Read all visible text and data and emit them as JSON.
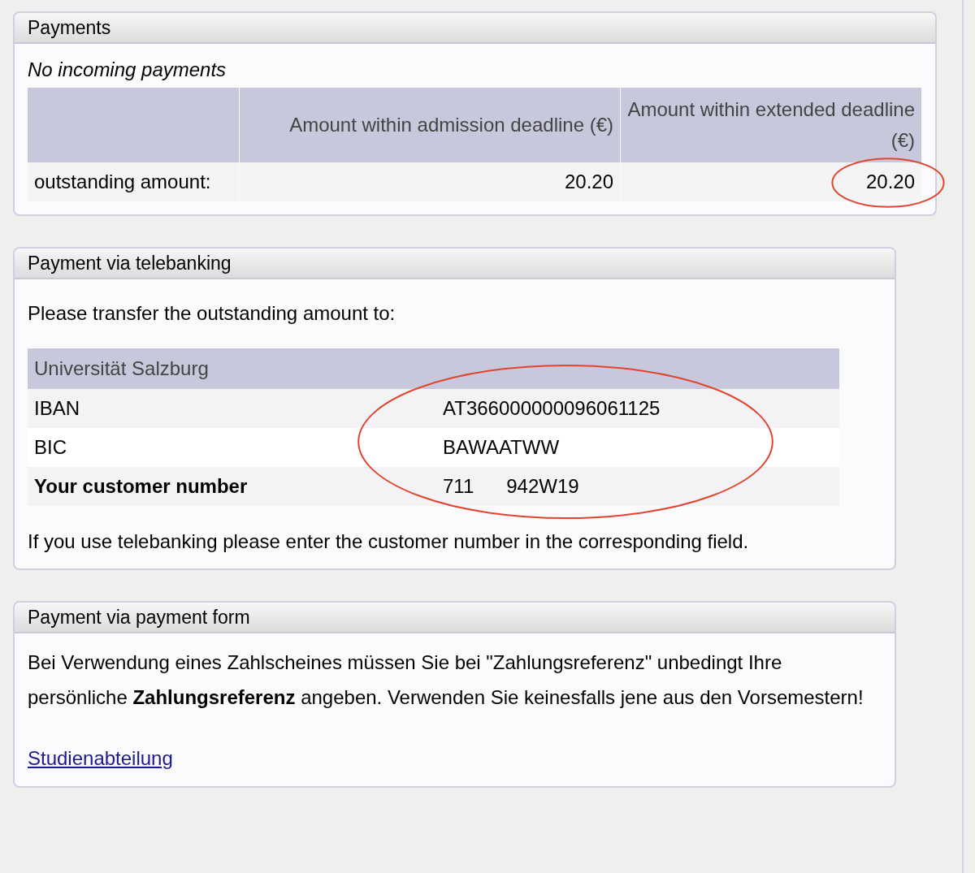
{
  "payments": {
    "title": "Payments",
    "note": "No incoming payments",
    "columns": [
      "Amount within admission deadline (€)",
      "Amount within extended deadline (€)"
    ],
    "rows": [
      {
        "label": "outstanding amount:",
        "values": [
          {
            "text": "20.20",
            "circled": false
          },
          {
            "text": "20.20",
            "circled": true
          }
        ]
      }
    ]
  },
  "telebanking": {
    "title": "Payment via telebanking",
    "intro": "Please transfer the outstanding amount to:",
    "bank": {
      "name": "Universität Salzburg",
      "circled": true,
      "rows": [
        {
          "label": "IBAN",
          "value": [
            "AT366000000096061125"
          ],
          "bold": false
        },
        {
          "label": "BIC",
          "value": [
            "BAWAATWW"
          ],
          "bold": false
        },
        {
          "label": "Your customer number",
          "value": [
            "711",
            "942W19"
          ],
          "bold": true
        }
      ]
    },
    "hint": "If you use telebanking please enter the customer number in the corresponding field."
  },
  "payment_form": {
    "title": "Payment via payment form",
    "text": "Bei Verwendung eines Zahlscheines müssen Sie bei \"Zahlungsreferenz\" unbedingt Ihre persönliche **Zahlungsreferenz** angeben. Verwenden Sie keinesfalls jene aus den Vorsemestern!",
    "link": "Studienabteilung"
  }
}
